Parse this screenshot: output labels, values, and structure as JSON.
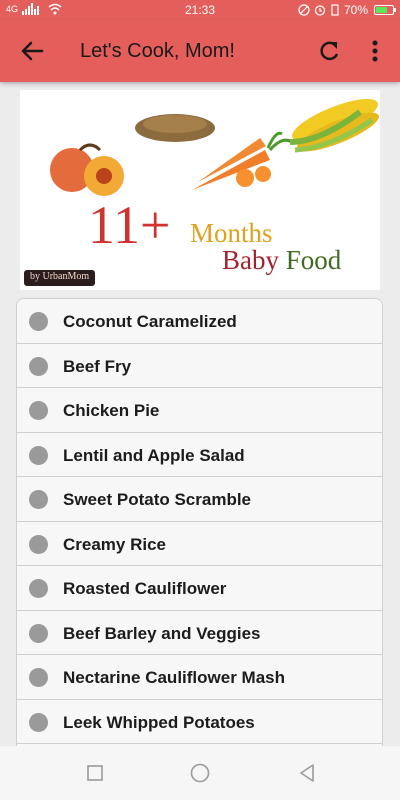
{
  "status_bar": {
    "signal": "4G",
    "time": "21:33",
    "battery": "70%",
    "battery_level": 0.7
  },
  "app_bar": {
    "title": "Let's Cook, Mom!",
    "back_icon": "arrow-back-icon",
    "refresh_icon": "refresh-icon",
    "more_icon": "more-vert-icon"
  },
  "banner": {
    "number": "11+",
    "months": "Months",
    "baby": "Baby",
    "food": "Food",
    "credit": "by UrbanMom"
  },
  "recipes": [
    "Coconut Caramelized",
    "Beef Fry",
    "Chicken Pie",
    "Lentil and Apple Salad",
    "Sweet Potato Scramble",
    "Creamy Rice",
    "Roasted Cauliflower",
    "Beef Barley and Veggies",
    "Nectarine Cauliflower Mash",
    "Leek Whipped Potatoes"
  ],
  "nav": {
    "recent_icon": "square-recents-icon",
    "home_icon": "circle-home-icon",
    "back_icon": "triangle-back-icon"
  }
}
